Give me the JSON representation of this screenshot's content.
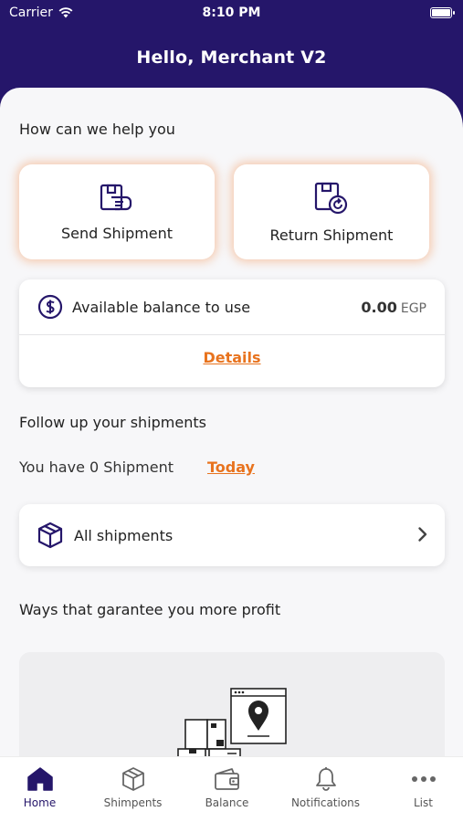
{
  "status_bar": {
    "carrier": "Carrier",
    "time": "8:10 PM"
  },
  "header": {
    "title": "Hello, Merchant V2"
  },
  "help_section": {
    "title": "How can we help you",
    "send_label": "Send Shipment",
    "return_label": "Return Shipment"
  },
  "balance": {
    "label": "Available balance to use",
    "value": "0.00",
    "currency": "EGP",
    "details_link": "Details"
  },
  "followup": {
    "title": "Follow up your shipments",
    "count_text": "You have 0 Shipment",
    "today_link": "Today",
    "all_shipments_label": "All shipments"
  },
  "profit_section": {
    "title": "Ways that garantee you more profit"
  },
  "tabs": [
    {
      "label": "Home",
      "icon": "home-icon"
    },
    {
      "label": "Shimpents",
      "icon": "box-icon"
    },
    {
      "label": "Balance",
      "icon": "wallet-icon"
    },
    {
      "label": "Notifications",
      "icon": "bell-icon"
    },
    {
      "label": "List",
      "icon": "more-icon"
    }
  ],
  "colors": {
    "brand": "#25166a",
    "accent": "#e8731e",
    "card_glow": "#f5965a"
  }
}
